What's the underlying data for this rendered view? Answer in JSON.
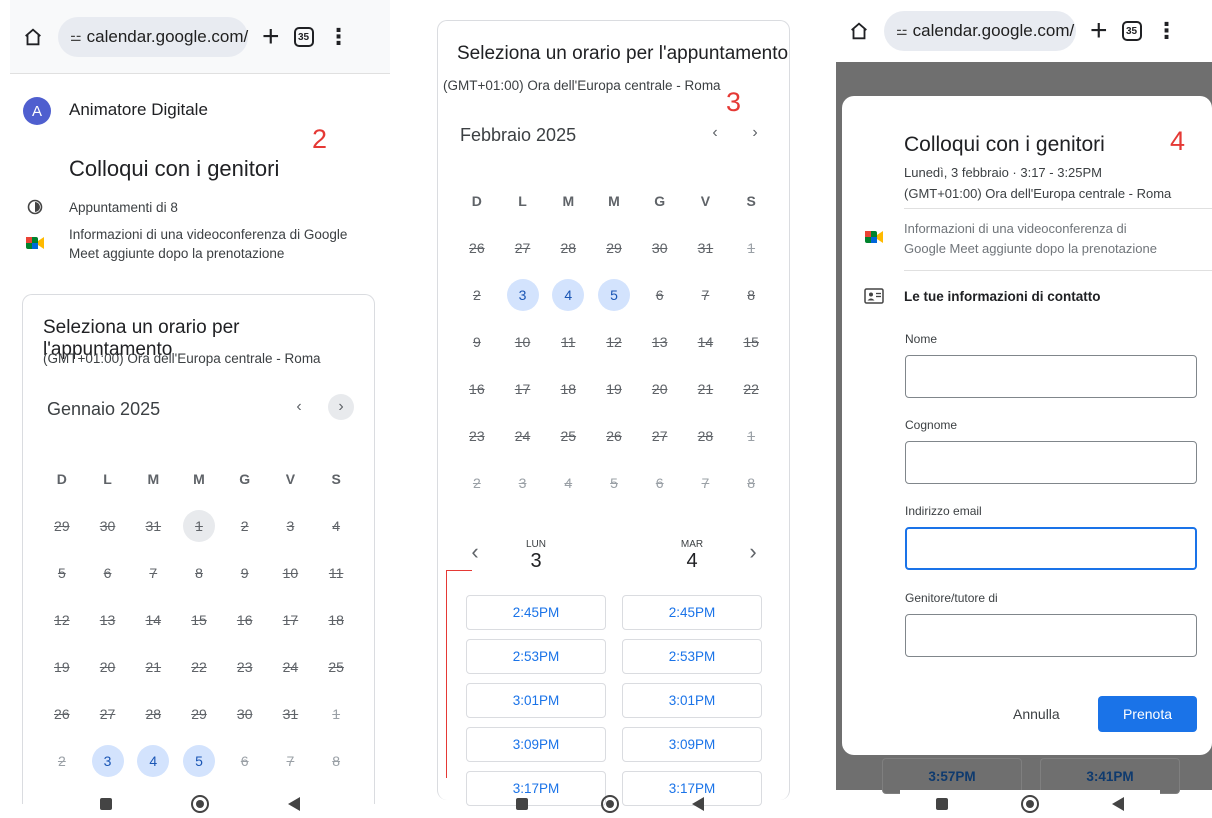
{
  "browser": {
    "url": "calendar.google.com/",
    "tab_count": "35"
  },
  "panel1": {
    "step_number": "2",
    "organizer_initial": "A",
    "organizer_name": "Animatore Digitale",
    "event_title": "Colloqui con i genitori",
    "duration_text": "Appuntamenti di 8",
    "meet_text_line1": "Informazioni di una videoconferenza di Google",
    "meet_text_line2": "Meet aggiunte dopo la prenotazione",
    "card_title": "Seleziona un orario per l'appuntamento",
    "timezone": "(GMT+01:00) Ora dell'Europa centrale - Roma",
    "month": "Gennaio 2025",
    "weekdays": [
      "D",
      "L",
      "M",
      "M",
      "G",
      "V",
      "S"
    ],
    "days": [
      "29",
      "30",
      "31",
      "1",
      "2",
      "3",
      "4",
      "5",
      "6",
      "7",
      "8",
      "9",
      "10",
      "11",
      "12",
      "13",
      "14",
      "15",
      "16",
      "17",
      "18",
      "19",
      "20",
      "21",
      "22",
      "23",
      "24",
      "25",
      "26",
      "27",
      "28",
      "29",
      "30",
      "31",
      "1",
      "2",
      "3",
      "4",
      "5",
      "6",
      "7",
      "8"
    ],
    "available_days": [
      "3",
      "4",
      "5"
    ]
  },
  "panel2": {
    "step_number": "3",
    "card_title": "Seleziona un orario per l'appuntamento",
    "timezone": "(GMT+01:00) Ora dell'Europa centrale - Roma",
    "month": "Febbraio 2025",
    "weekdays": [
      "D",
      "L",
      "M",
      "M",
      "G",
      "V",
      "S"
    ],
    "days": [
      "26",
      "27",
      "28",
      "29",
      "30",
      "31",
      "1",
      "2",
      "3",
      "4",
      "5",
      "6",
      "7",
      "8",
      "9",
      "10",
      "11",
      "12",
      "13",
      "14",
      "15",
      "16",
      "17",
      "18",
      "19",
      "20",
      "21",
      "22",
      "23",
      "24",
      "25",
      "26",
      "27",
      "28",
      "1",
      "2",
      "3",
      "4",
      "5",
      "6",
      "7",
      "8"
    ],
    "available_days": [
      "3",
      "4",
      "5"
    ],
    "day1": {
      "label": "LUN",
      "number": "3"
    },
    "day2": {
      "label": "MAR",
      "number": "4"
    },
    "slots_day1": [
      "2:45PM",
      "2:53PM",
      "3:01PM",
      "3:09PM",
      "3:17PM"
    ],
    "slots_day2": [
      "2:45PM",
      "2:53PM",
      "3:01PM",
      "3:09PM",
      "3:17PM"
    ]
  },
  "panel3": {
    "step_number": "4",
    "title": "Colloqui con i genitori",
    "datetime": "Lunedì, 3 febbraio · 3:17 - 3:25PM",
    "timezone": "(GMT+01:00) Ora dell'Europa centrale - Roma",
    "meet_line1": "Informazioni di una videoconferenza di",
    "meet_line2": "Google Meet aggiunte dopo la prenotazione",
    "contact_heading": "Le tue informazioni di contatto",
    "field_name": "Nome",
    "field_surname": "Cognome",
    "field_email": "Indirizzo email",
    "field_parent": "Genitore/tutore di",
    "cancel_label": "Annulla",
    "book_label": "Prenota",
    "bg_slot_left": "3:57PM",
    "bg_slot_right": "3:41PM"
  },
  "colors": {
    "accent": "#1a73e8",
    "available_day_bg": "#d3e3fd",
    "step_number": "#e53935"
  }
}
